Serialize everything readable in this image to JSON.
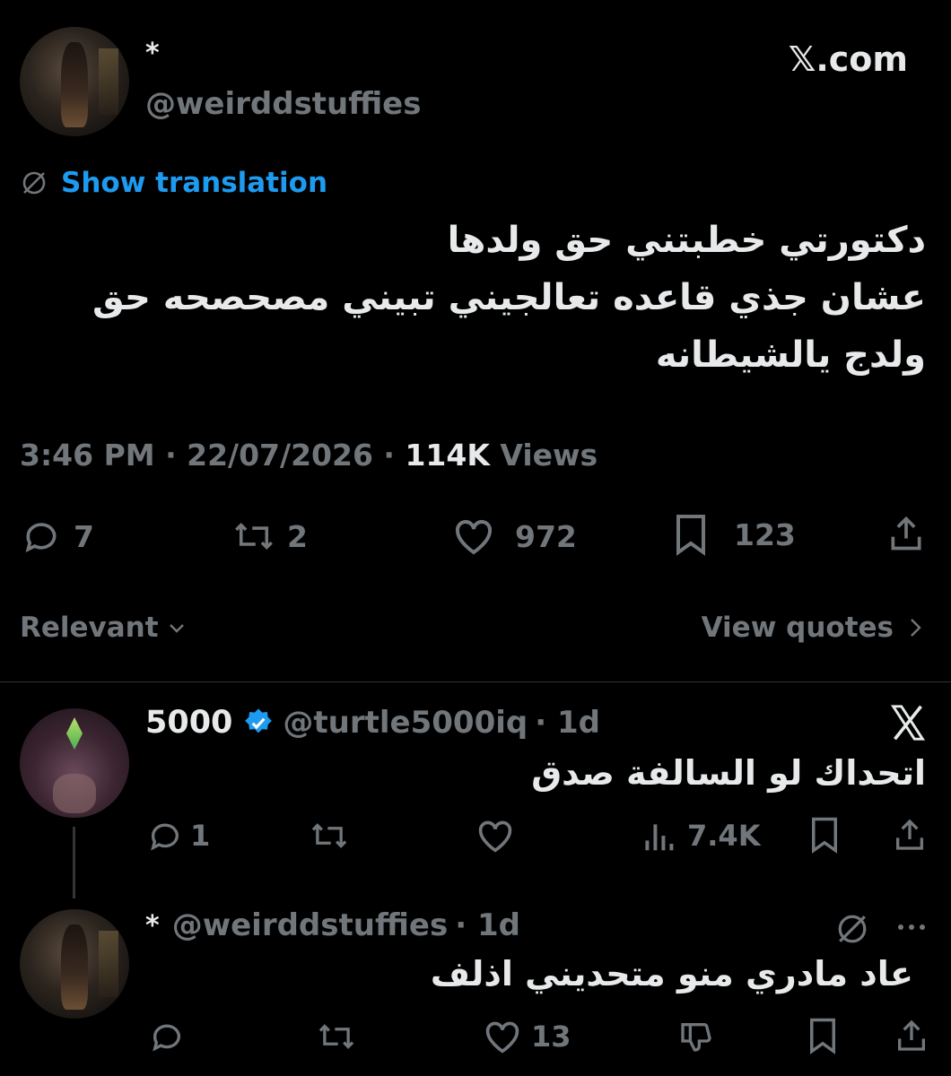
{
  "site_logo": "𝕏.com",
  "tweet": {
    "display_name": "*",
    "handle": "@weirddstuffies",
    "show_translation": "Show translation",
    "text_lines": [
      "دكتورتي خطبتني حق ولدها",
      "عشان جذي قاعده تعالجيني تبيني مصحصحه حق",
      "ولدج يالشيطانه"
    ],
    "time": "3:46 PM",
    "date": "22/07/2026",
    "views_count": "114K",
    "views_label": "Views",
    "replies": "7",
    "reposts": "2",
    "likes": "972",
    "bookmarks": "123"
  },
  "sort": {
    "label": "Relevant",
    "view_quotes": "View quotes"
  },
  "reply1": {
    "display_name": "5000",
    "handle": "@turtle5000iq",
    "age": "· 1d",
    "text": "اتحداك لو السالفة صدق",
    "replies": "1",
    "views": "7.4K"
  },
  "reply2": {
    "display_name": "*",
    "handle": "@weirddstuffies",
    "age": "· 1d",
    "text": "عاد مادري منو متحديني اذلف",
    "likes": "13"
  },
  "colors": {
    "background": "#000000",
    "text": "#e7e9ea",
    "muted": "#71767b",
    "link": "#1d9bf0",
    "divider": "#2f3336"
  },
  "icons": [
    "translate-icon",
    "reply-icon",
    "repost-icon",
    "like-icon",
    "bookmark-icon",
    "share-icon",
    "views-icon",
    "dislike-icon",
    "more-icon",
    "verified-badge-icon",
    "x-logo-icon",
    "chevron-down-icon",
    "chevron-right-icon"
  ]
}
